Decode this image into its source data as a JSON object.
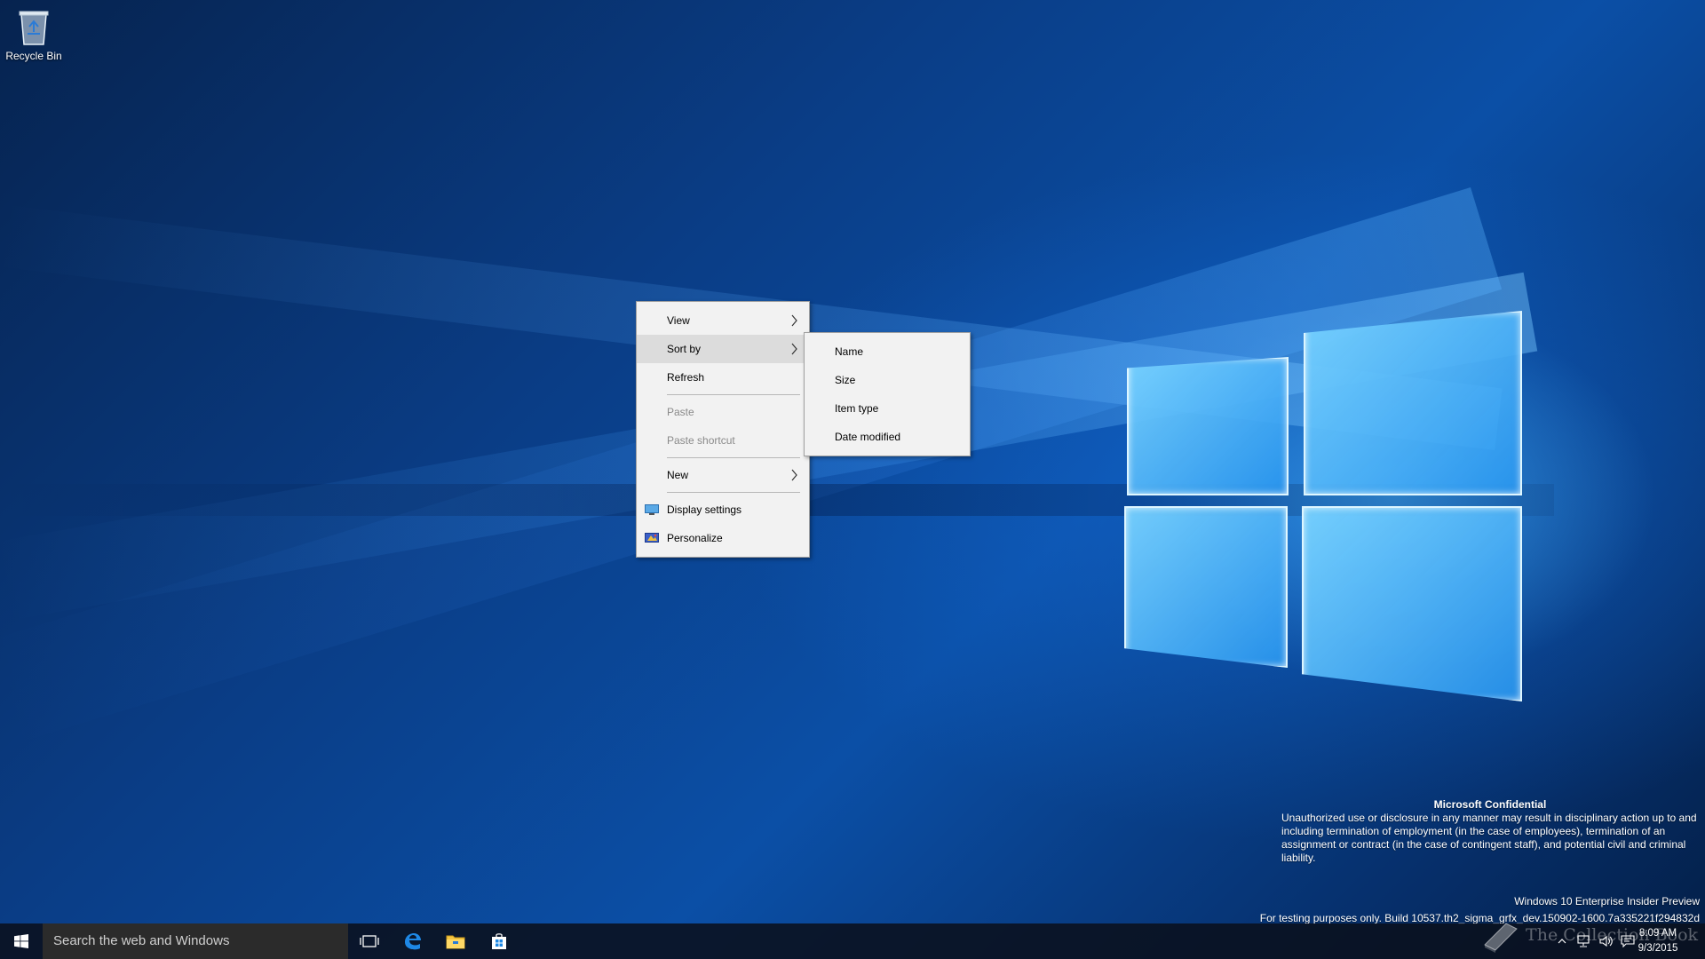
{
  "desktop": {
    "icons": [
      {
        "label": "Recycle Bin",
        "icon": "recycle-bin-icon"
      }
    ]
  },
  "context_menu": {
    "items": [
      {
        "label": "View",
        "submenu": true,
        "enabled": true
      },
      {
        "label": "Sort by",
        "submenu": true,
        "enabled": true,
        "highlighted": true
      },
      {
        "label": "Refresh",
        "submenu": false,
        "enabled": true
      },
      {
        "label": "Paste",
        "submenu": false,
        "enabled": false
      },
      {
        "label": "Paste shortcut",
        "submenu": false,
        "enabled": false
      },
      {
        "label": "New",
        "submenu": true,
        "enabled": true
      },
      {
        "label": "Display settings",
        "icon": "display-settings-icon",
        "enabled": true
      },
      {
        "label": "Personalize",
        "icon": "personalize-icon",
        "enabled": true
      }
    ]
  },
  "sort_submenu": {
    "items": [
      {
        "label": "Name"
      },
      {
        "label": "Size"
      },
      {
        "label": "Item type"
      },
      {
        "label": "Date modified"
      }
    ]
  },
  "watermark_text": {
    "title": "Microsoft Confidential",
    "body": "Unauthorized use or disclosure in any manner may result in disciplinary action up to and including termination of employment (in the case of employees), termination of an assignment or contract (in the case of contingent staff), and potential civil and criminal liability.",
    "edition": "Windows 10 Enterprise Insider Preview",
    "build": "For testing purposes only. Build 10537.th2_sigma_grfx_dev.150902-1600.7a335221f294832d"
  },
  "taskbar": {
    "search_placeholder": "Search the web and Windows",
    "buttons": [
      {
        "name": "task-view",
        "icon": "task-view-icon"
      },
      {
        "name": "edge",
        "icon": "edge-icon"
      },
      {
        "name": "file-explorer",
        "icon": "folder-icon"
      },
      {
        "name": "store",
        "icon": "store-icon"
      }
    ],
    "clock": {
      "time": "8:09 AM",
      "date": "9/3/2015"
    }
  },
  "watermark_logo": "The Collection Book",
  "colors": {
    "menu_bg": "#f2f2f2",
    "menu_hover": "#dcdcdc",
    "taskbar_bg": "#0a101c",
    "search_bg": "#2b2b2b",
    "desktop_blue": "#0b4fa6"
  }
}
